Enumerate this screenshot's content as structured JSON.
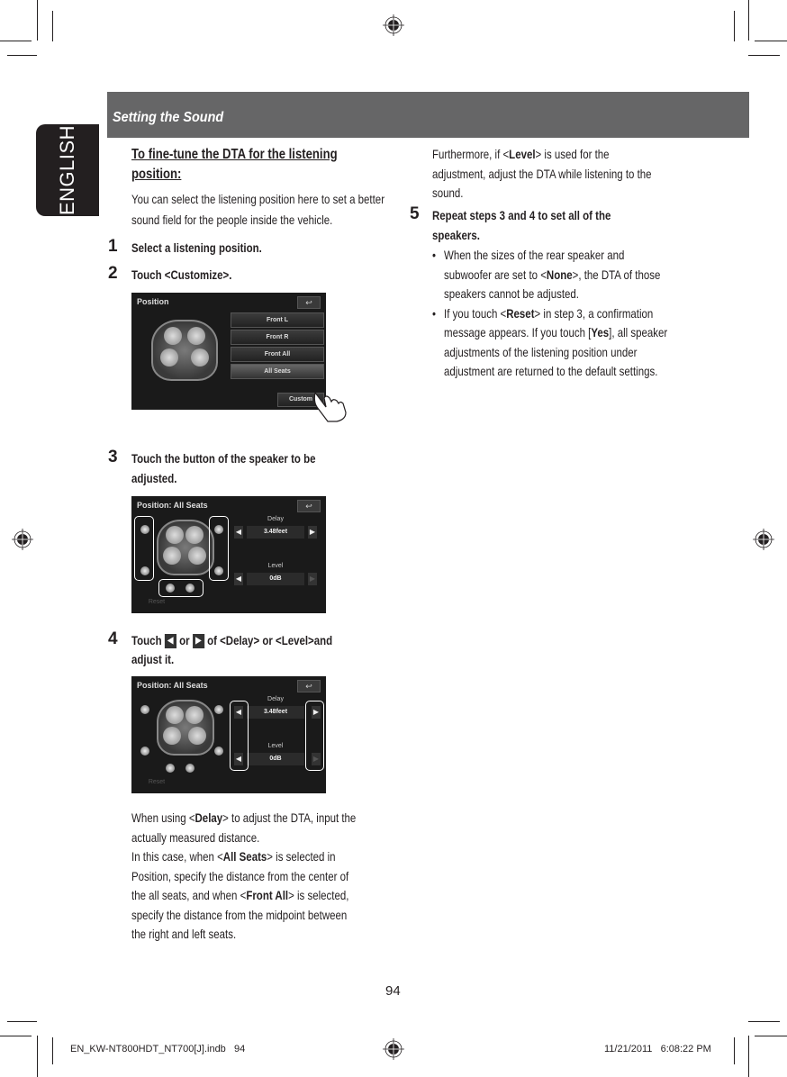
{
  "language_tab": "ENGLISH",
  "section_header": "Setting the Sound",
  "section_title_line1": "To fine-tune the DTA for the listening ",
  "section_title_line2": "position:",
  "intro": [
    "You can select the listening position here to set a better",
    "sound field for the people inside the vehicle."
  ],
  "steps": [
    {
      "num": "1",
      "text": "Select a listening position."
    },
    {
      "num": "2",
      "text": "Touch <Customize>."
    },
    {
      "num": "3",
      "lines": [
        "Touch the button of the speaker to be",
        "adjusted."
      ]
    },
    {
      "num": "4",
      "prefix": "Touch",
      "mid": "or",
      "suffix": "of <Delay> or <Level>and",
      "line2": "adjust it."
    },
    {
      "num": "5",
      "lines": [
        "Repeat steps 3 and 4 to set all of the",
        "speakers."
      ]
    }
  ],
  "screen_position": {
    "title": "Position",
    "back_icon": "back-arrow-icon",
    "options": [
      "Front L",
      "Front R",
      "Front All",
      "All Seats"
    ],
    "customize": "Custom"
  },
  "screen_all_seats": {
    "title": "Position: All Seats",
    "delay_label": "Delay",
    "delay_value": "3.48feet",
    "level_label": "Level",
    "level_value": "0dB",
    "reset": "Reset"
  },
  "step4_note": [
    {
      "pre": "When using <",
      "b": "Delay",
      "post": "> to adjust the DTA, input the"
    },
    {
      "pre": "actually measured distance.",
      "b": "",
      "post": ""
    },
    {
      "pre": "In this case, when <",
      "b": "All Seats",
      "post": "> is selected in"
    },
    {
      "pre": "Position, specify the distance from the center of",
      "b": "",
      "post": ""
    },
    {
      "pre": "the all seats, and when <",
      "b": "Front All",
      "post": "> is selected,"
    },
    {
      "pre": "specify the distance from the midpoint between",
      "b": "",
      "post": ""
    },
    {
      "pre": "the right and left seats.",
      "b": "",
      "post": ""
    }
  ],
  "right_col_intro": [
    {
      "pre": "Furthermore, if <",
      "b": "Level",
      "post": "> is used for the"
    },
    {
      "pre": "adjustment, adjust the DTA while listening to the",
      "b": "",
      "post": ""
    },
    {
      "pre": "sound.",
      "b": "",
      "post": ""
    }
  ],
  "bullets": [
    [
      {
        "pre": "When the sizes of the rear speaker and",
        "b": "",
        "post": ""
      },
      {
        "pre": "subwoofer are set to <",
        "b": "None",
        "post": ">, the DTA of those"
      },
      {
        "pre": "speakers cannot be adjusted.",
        "b": "",
        "post": ""
      }
    ],
    [
      {
        "pre": "If you touch <",
        "b": "Reset",
        "post": "> in step 3, a confirmation"
      },
      {
        "pre": "message appears. If you touch [",
        "b": "Yes",
        "post": "], all speaker"
      },
      {
        "pre": "adjustments of the listening position under",
        "b": "",
        "post": ""
      },
      {
        "pre": "adjustment are returned to the default settings.",
        "b": "",
        "post": ""
      }
    ]
  ],
  "bullet_char": "•",
  "page_number": "94",
  "footer_left": "EN_KW-NT800HDT_NT700[J].indb   94",
  "footer_right": "11/21/2011   6:08:22 PM",
  "colors": {
    "header_bar": "#666667",
    "tab": "#231f20",
    "text": "#231f20"
  }
}
